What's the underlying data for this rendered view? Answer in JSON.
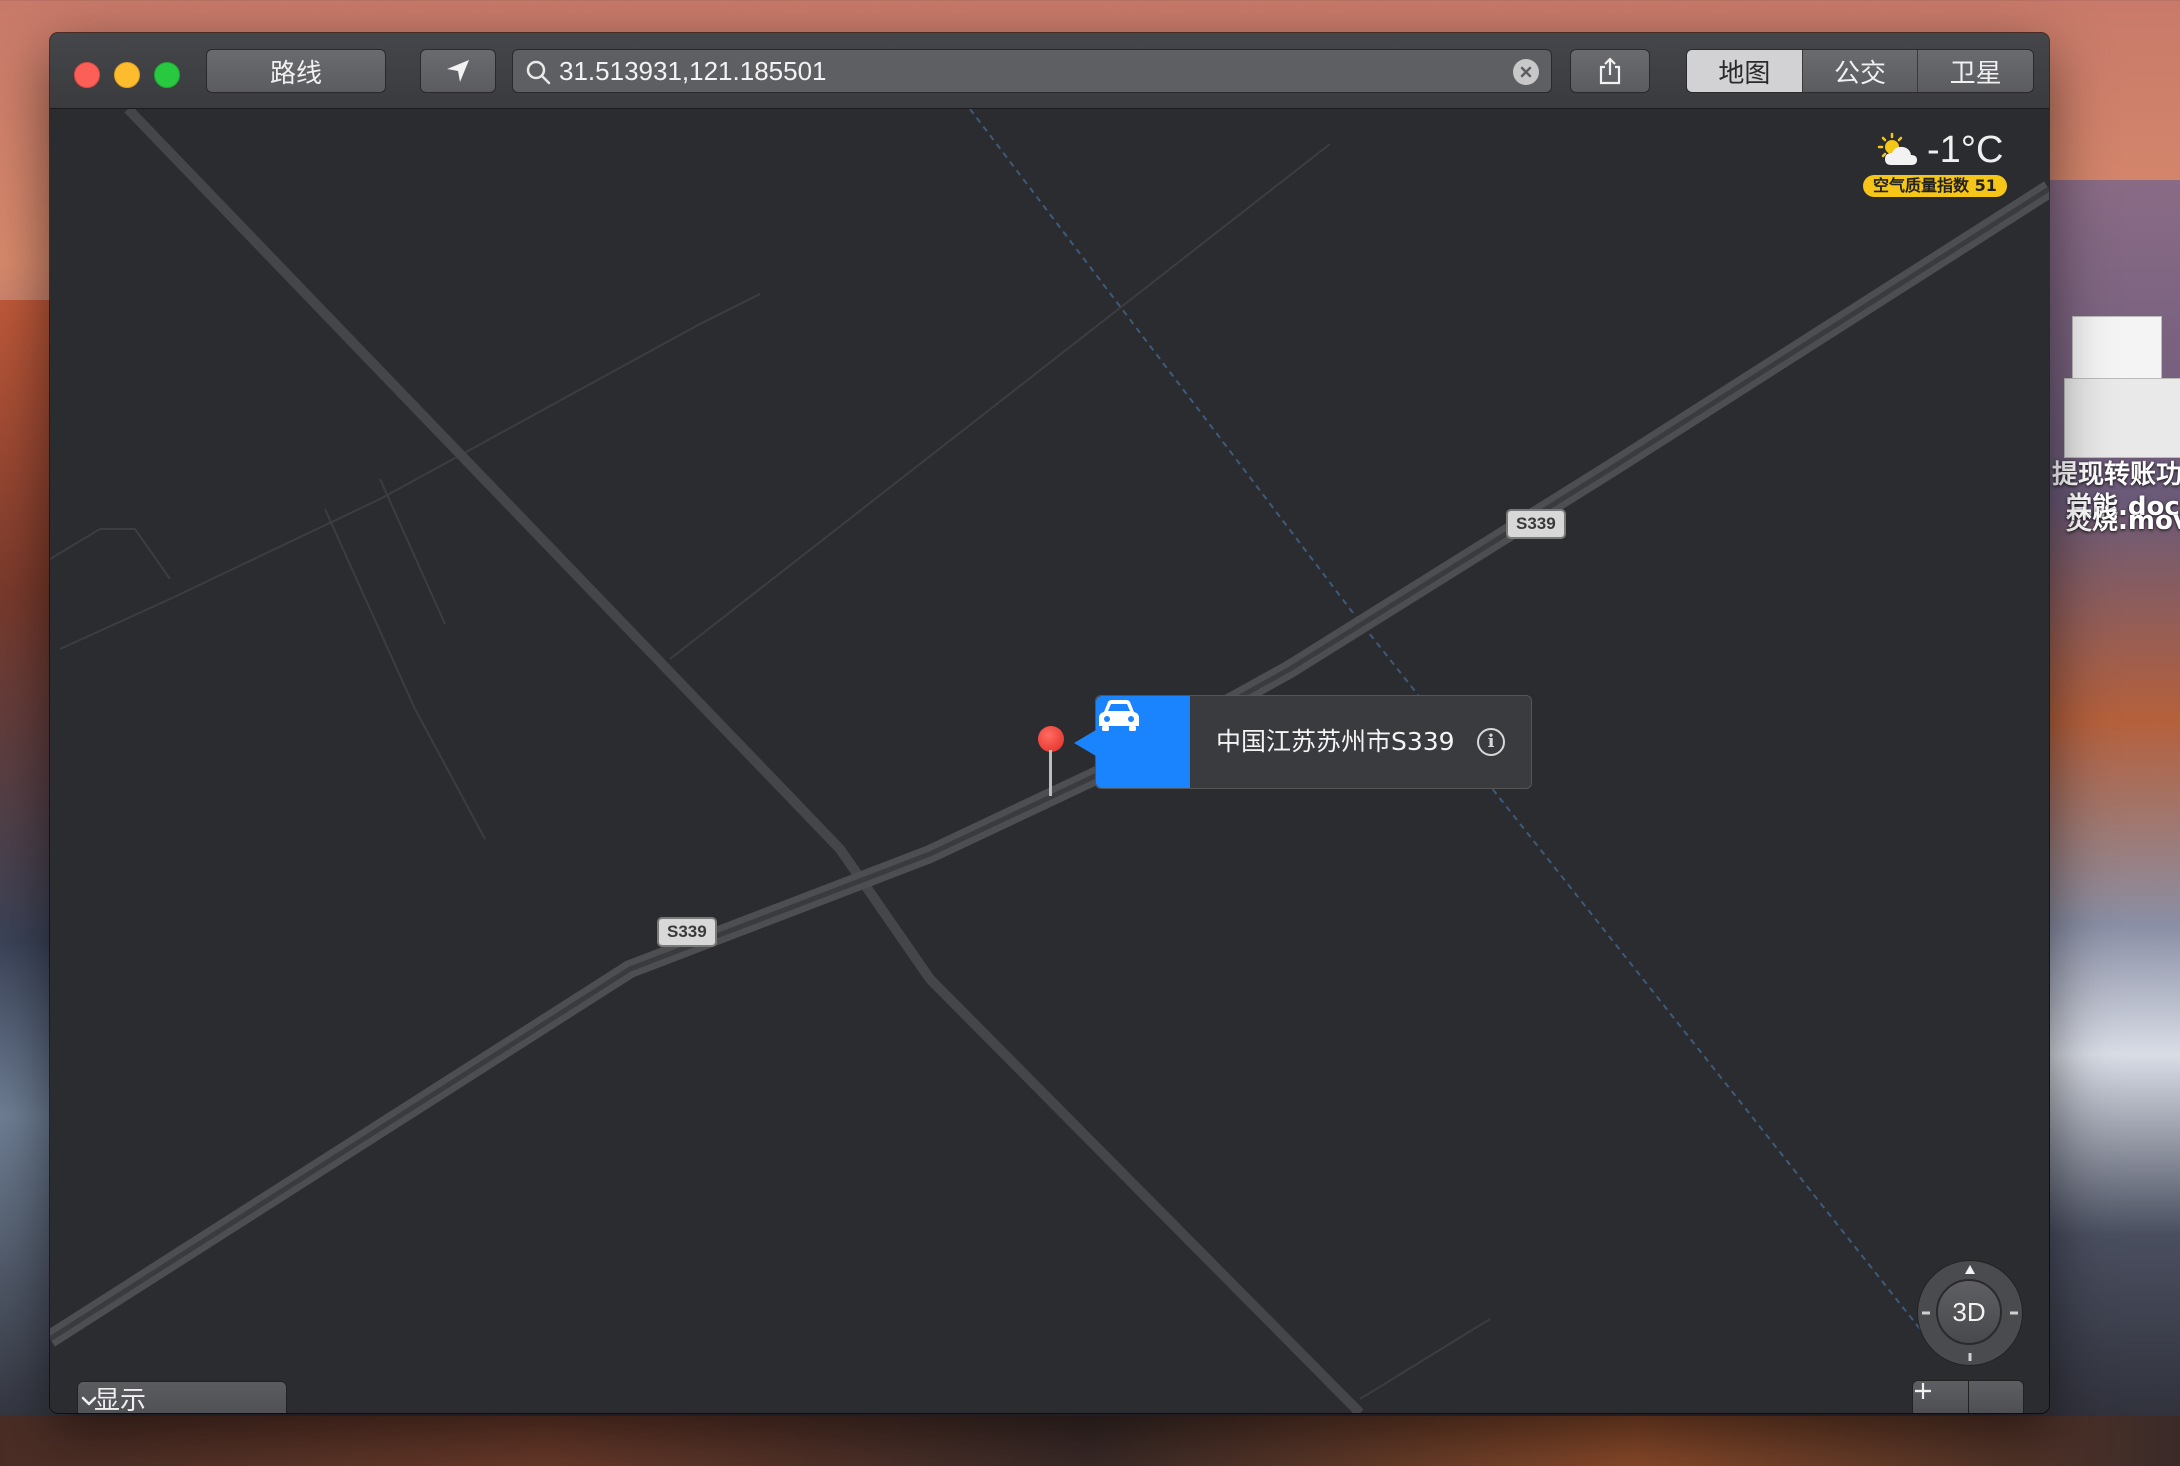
{
  "toolbar": {
    "route_label": "路线",
    "search_value": "31.513931,121.185501",
    "tabs": [
      {
        "label": "地图",
        "active": true
      },
      {
        "label": "公交",
        "active": false
      },
      {
        "label": "卫星",
        "active": false
      }
    ]
  },
  "map": {
    "road_shields": [
      "S339",
      "S339"
    ],
    "callout": {
      "title": "中国江苏苏州市S339",
      "icon": "car-icon",
      "accent_color": "#1a84ff"
    },
    "weather": {
      "temperature": "-1°C",
      "aqi_label": "空气质量指数 51",
      "icon": "partly-cloudy-icon"
    },
    "display_select": "显示",
    "compass_label": "3D"
  },
  "desktop": {
    "files": [
      {
        "label_line1": "提现转账功",
        "label_line2": "能.docx"
      },
      {
        "label_line1": "党",
        "label_line2": "焚烧.mov"
      }
    ]
  }
}
